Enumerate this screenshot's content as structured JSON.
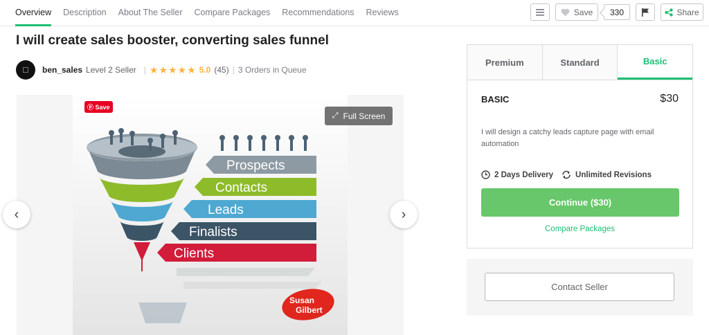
{
  "nav": {
    "tabs": [
      "Overview",
      "Description",
      "About The Seller",
      "Compare Packages",
      "Recommendations",
      "Reviews"
    ],
    "save_label": "Save",
    "save_count": "330",
    "share_label": "Share"
  },
  "gig": {
    "title": "I will create sales booster, converting sales funnel",
    "seller_name": "ben_sales",
    "seller_level": "Level 2 Seller",
    "rating": "5.0",
    "review_count": "(45)",
    "queue": "3 Orders in Queue"
  },
  "gallery": {
    "pin_save": "Save",
    "fullscreen_label": "Full Screen",
    "funnel_stages": [
      "Prospects",
      "Contacts",
      "Leads",
      "Finalists",
      "Clients"
    ],
    "logo_line1": "Susan",
    "logo_line2": "Gilbert"
  },
  "package": {
    "tabs": [
      "Premium",
      "Standard",
      "Basic"
    ],
    "active_tab": "Basic",
    "name": "BASIC",
    "price": "$30",
    "description": "I will design a catchy leads capture page with email automation",
    "delivery": "2 Days Delivery",
    "revisions": "Unlimited Revisions",
    "continue_label": "Continue ($30)",
    "compare_label": "Compare Packages"
  },
  "contact": {
    "label": "Contact Seller"
  },
  "colors": {
    "accent": "#1dbf73",
    "continue": "#67c76a",
    "star": "#ffb33e"
  }
}
